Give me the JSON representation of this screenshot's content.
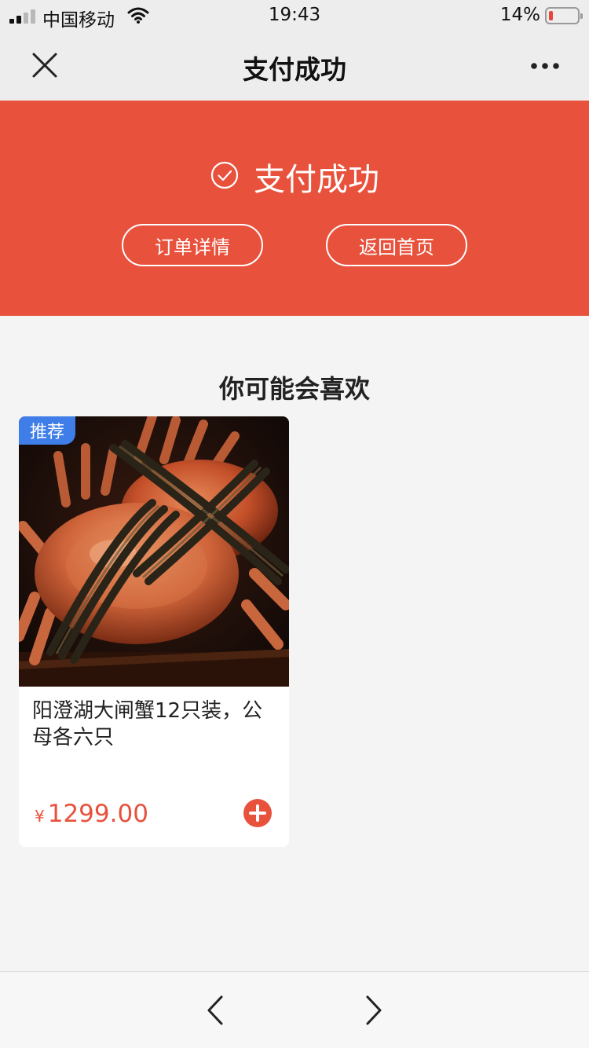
{
  "status_bar": {
    "carrier": "中国移动",
    "time": "19:43",
    "battery_percent": "14%",
    "battery_level": 0.14,
    "signal_icon": "signal-bars-icon",
    "wifi_icon": "wifi-icon"
  },
  "nav": {
    "title": "支付成功",
    "close_icon": "close-icon",
    "more_icon": "more-dots-icon"
  },
  "banner": {
    "success_text": "支付成功",
    "success_icon": "check-circle-icon",
    "order_details_label": "订单详情",
    "home_label": "返回首页",
    "background_color": "#e8513c"
  },
  "recommend": {
    "title": "你可能会喜欢",
    "items": [
      {
        "badge": "推荐",
        "title": "阳澄湖大闸蟹12只装，公母各六只",
        "currency": "¥",
        "price": "1299.00",
        "add_icon": "add-circle-icon"
      }
    ]
  },
  "toolbar": {
    "back_icon": "chevron-left-icon",
    "forward_icon": "chevron-right-icon"
  },
  "colors": {
    "accent": "#e8513c",
    "badge": "#3f7ee8",
    "nav_background": "#ededed",
    "page_background": "#f4f4f4"
  }
}
